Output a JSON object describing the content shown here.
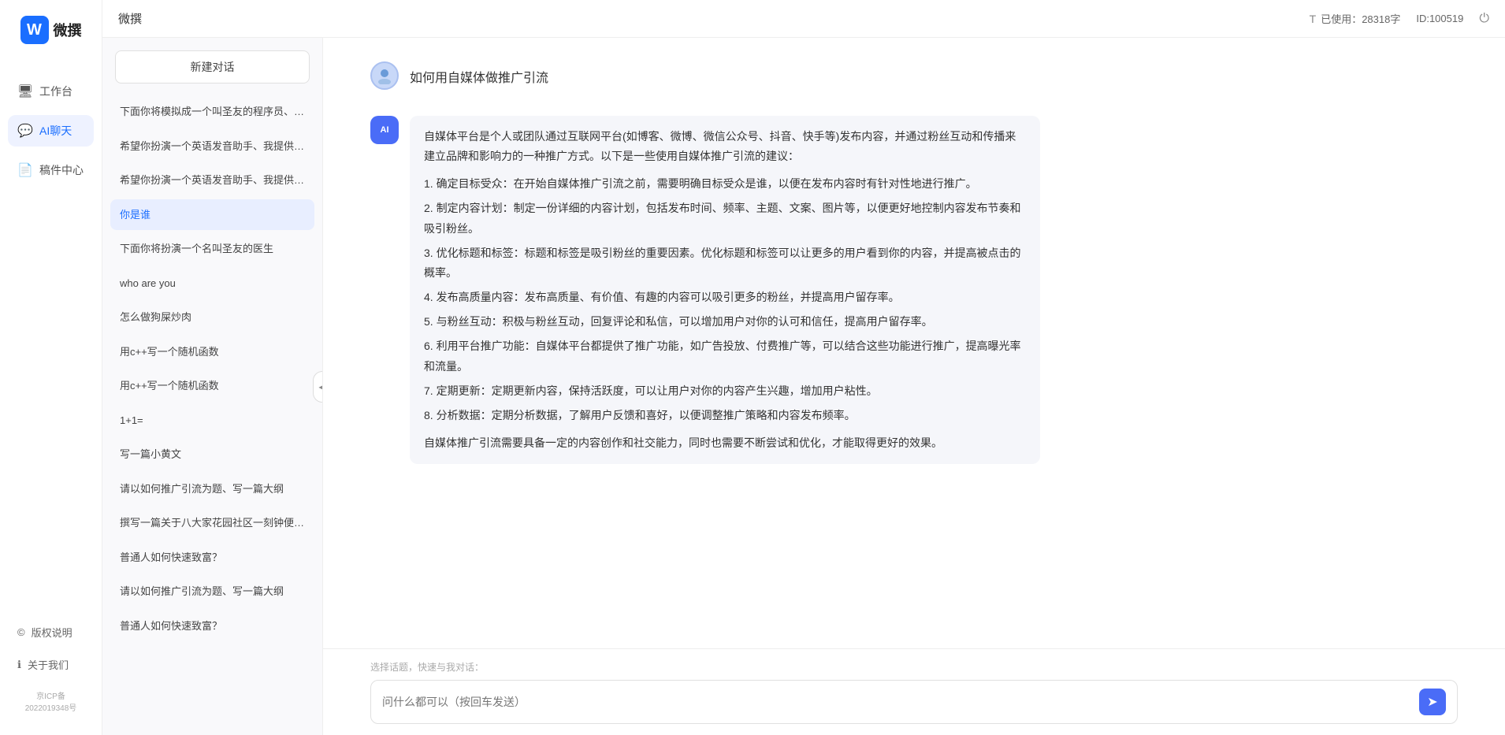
{
  "app": {
    "title": "微撰",
    "logo_letter": "W",
    "logo_text": "微撰"
  },
  "topbar": {
    "title": "微撰",
    "usage_label": "已使用：28318字",
    "id_label": "ID:100519",
    "usage_icon": "T"
  },
  "nav": {
    "items": [
      {
        "id": "workbench",
        "label": "工作台",
        "icon": "🖥"
      },
      {
        "id": "ai-chat",
        "label": "AI聊天",
        "icon": "💬",
        "active": true
      },
      {
        "id": "drafts",
        "label": "稿件中心",
        "icon": "📄"
      }
    ],
    "bottom_items": [
      {
        "id": "copyright",
        "label": "版权说明",
        "icon": "©"
      },
      {
        "id": "about",
        "label": "关于我们",
        "icon": "ℹ"
      }
    ],
    "icp": "京ICP备2022019348号"
  },
  "chat_sidebar": {
    "new_chat_label": "新建对话",
    "collapse_icon": "◀",
    "history": [
      {
        "id": "h1",
        "text": "下面你将模拟成一个叫圣友的程序员、我说..."
      },
      {
        "id": "h2",
        "text": "希望你扮演一个英语发音助手、我提供给你..."
      },
      {
        "id": "h3",
        "text": "希望你扮演一个英语发音助手、我提供给你..."
      },
      {
        "id": "h4",
        "text": "你是谁",
        "active": true
      },
      {
        "id": "h5",
        "text": "下面你将扮演一个名叫圣友的医生"
      },
      {
        "id": "h6",
        "text": "who are you"
      },
      {
        "id": "h7",
        "text": "怎么做狗屎炒肉"
      },
      {
        "id": "h8",
        "text": "用c++写一个随机函数"
      },
      {
        "id": "h9",
        "text": "用c++写一个随机函数"
      },
      {
        "id": "h10",
        "text": "1+1="
      },
      {
        "id": "h11",
        "text": "写一篇小黄文"
      },
      {
        "id": "h12",
        "text": "请以如何推广引流为题、写一篇大纲"
      },
      {
        "id": "h13",
        "text": "撰写一篇关于八大家花园社区一刻钟便民生..."
      },
      {
        "id": "h14",
        "text": "普通人如何快速致富？"
      },
      {
        "id": "h15",
        "text": "请以如何推广引流为题、写一篇大纲"
      },
      {
        "id": "h16",
        "text": "普通人如何快速致富？"
      }
    ]
  },
  "chat": {
    "user_question": "如何用自媒体做推广引流",
    "ai_response_paragraphs": [
      "自媒体平台是个人或团队通过互联网平台(如博客、微博、微信公众号、抖音、快手等)发布内容，并通过粉丝互动和传播来建立品牌和影响力的一种推广方式。以下是一些使用自媒体推广引流的建议：",
      "1. 确定目标受众：在开始自媒体推广引流之前，需要明确目标受众是谁，以便在发布内容时有针对性地进行推广。",
      "2. 制定内容计划：制定一份详细的内容计划，包括发布时间、频率、主题、文案、图片等，以便更好地控制内容发布节奏和吸引粉丝。",
      "3. 优化标题和标签：标题和标签是吸引粉丝的重要因素。优化标题和标签可以让更多的用户看到你的内容，并提高被点击的概率。",
      "4. 发布高质量内容：发布高质量、有价值、有趣的内容可以吸引更多的粉丝，并提高用户留存率。",
      "5. 与粉丝互动：积极与粉丝互动，回复评论和私信，可以增加用户对你的认可和信任，提高用户留存率。",
      "6. 利用平台推广功能：自媒体平台都提供了推广功能，如广告投放、付费推广等，可以结合这些功能进行推广，提高曝光率和流量。",
      "7. 定期更新：定期更新内容，保持活跃度，可以让用户对你的内容产生兴趣，增加用户粘性。",
      "8. 分析数据：定期分析数据，了解用户反馈和喜好，以便调整推广策略和内容发布频率。",
      "自媒体推广引流需要具备一定的内容创作和社交能力，同时也需要不断尝试和优化，才能取得更好的效果。"
    ],
    "quick_topic_label": "选择话题，快速与我对话：",
    "input_placeholder": "问什么都可以（按回车发送）",
    "send_icon": "➤"
  }
}
